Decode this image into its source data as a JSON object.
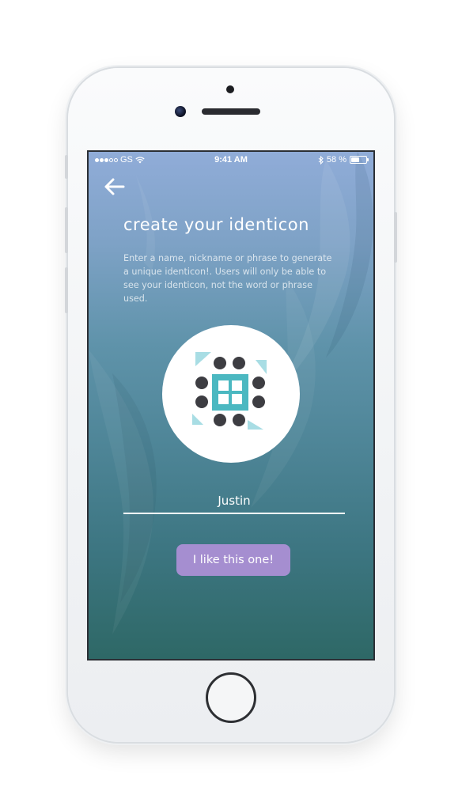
{
  "status_bar": {
    "carrier": "GS",
    "time": "9:41 AM",
    "battery": "58 %",
    "battery_level": 0.58,
    "icons": [
      "signal-dots-icon",
      "wifi-icon",
      "bluetooth-icon",
      "battery-icon"
    ]
  },
  "nav": {
    "back_icon": "arrow-left-icon"
  },
  "header": {
    "title": "create your identicon",
    "description": "Enter a name, nickname or phrase to generate a unique identicon!. Users will only be able to see your identicon, not the word or phrase used."
  },
  "identicon": {
    "accent_color": "#4bb8c1",
    "light_accent_color": "#a8dde4",
    "dot_color": "#3d3d42"
  },
  "name_input": {
    "value": "Justin"
  },
  "actions": {
    "confirm_label": "I like this one!"
  },
  "colors": {
    "button": "#a58ed0",
    "gradient_top": "#90acd8",
    "gradient_bottom": "#2e6866"
  }
}
